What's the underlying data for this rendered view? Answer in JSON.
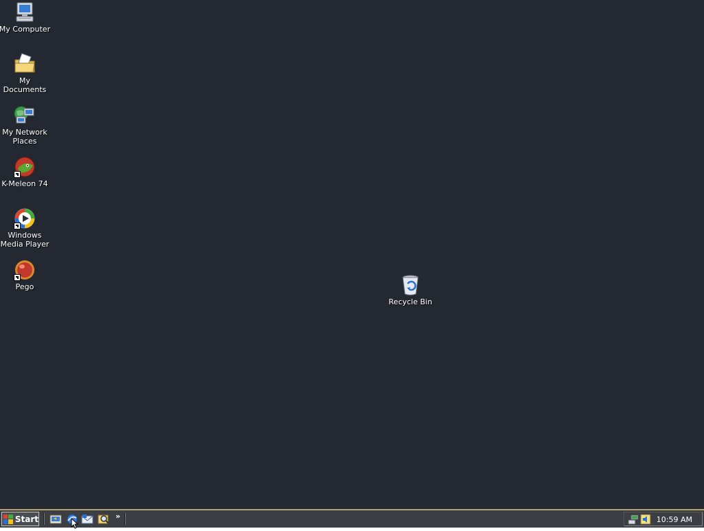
{
  "desktop": {
    "icons": [
      {
        "label": "My Computer",
        "icon": "my-computer-icon"
      },
      {
        "label": "My Documents",
        "icon": "my-documents-icon"
      },
      {
        "label": "My Network Places",
        "icon": "network-places-icon"
      },
      {
        "label": "K-Meleon 74",
        "icon": "k-meleon-icon",
        "shortcut": true
      },
      {
        "label": "Windows Media Player",
        "icon": "media-player-icon",
        "shortcut": true
      },
      {
        "label": "Pego",
        "icon": "pego-icon",
        "shortcut": true
      },
      {
        "label": "Recycle Bin",
        "icon": "recycle-bin-icon"
      }
    ],
    "background_color": "#232831"
  },
  "taskbar": {
    "start_label": "Start",
    "quick_launch": [
      {
        "icon": "show-desktop-icon"
      },
      {
        "icon": "browser-icon"
      },
      {
        "icon": "mail-icon"
      },
      {
        "icon": "search-icon"
      }
    ],
    "chevron": "»",
    "tray": [
      {
        "icon": "network-tray-icon"
      },
      {
        "icon": "volume-tray-icon"
      }
    ],
    "clock": "10:59 AM"
  }
}
